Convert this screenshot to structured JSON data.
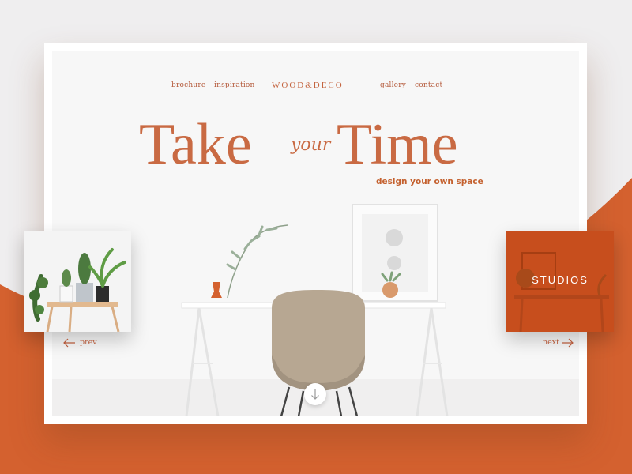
{
  "nav": {
    "left": [
      "brochure",
      "inspiration"
    ],
    "brand": "WOOD&DECO",
    "right": [
      "gallery",
      "contact"
    ]
  },
  "hero": {
    "title_left": "Take",
    "title_script": "your",
    "title_right": "Time",
    "tagline": "design your own space"
  },
  "slider": {
    "prev_label": "prev",
    "next_label": "next",
    "next_card_label": "STUDIOS"
  },
  "colors": {
    "accent": "#d4612f",
    "headline": "#c96a43",
    "card_overlay": "#c74e1d",
    "background": "#efeeef"
  },
  "icons": {
    "prev": "arrow-left-icon",
    "next": "arrow-right-icon",
    "scroll": "arrow-down-icon"
  }
}
